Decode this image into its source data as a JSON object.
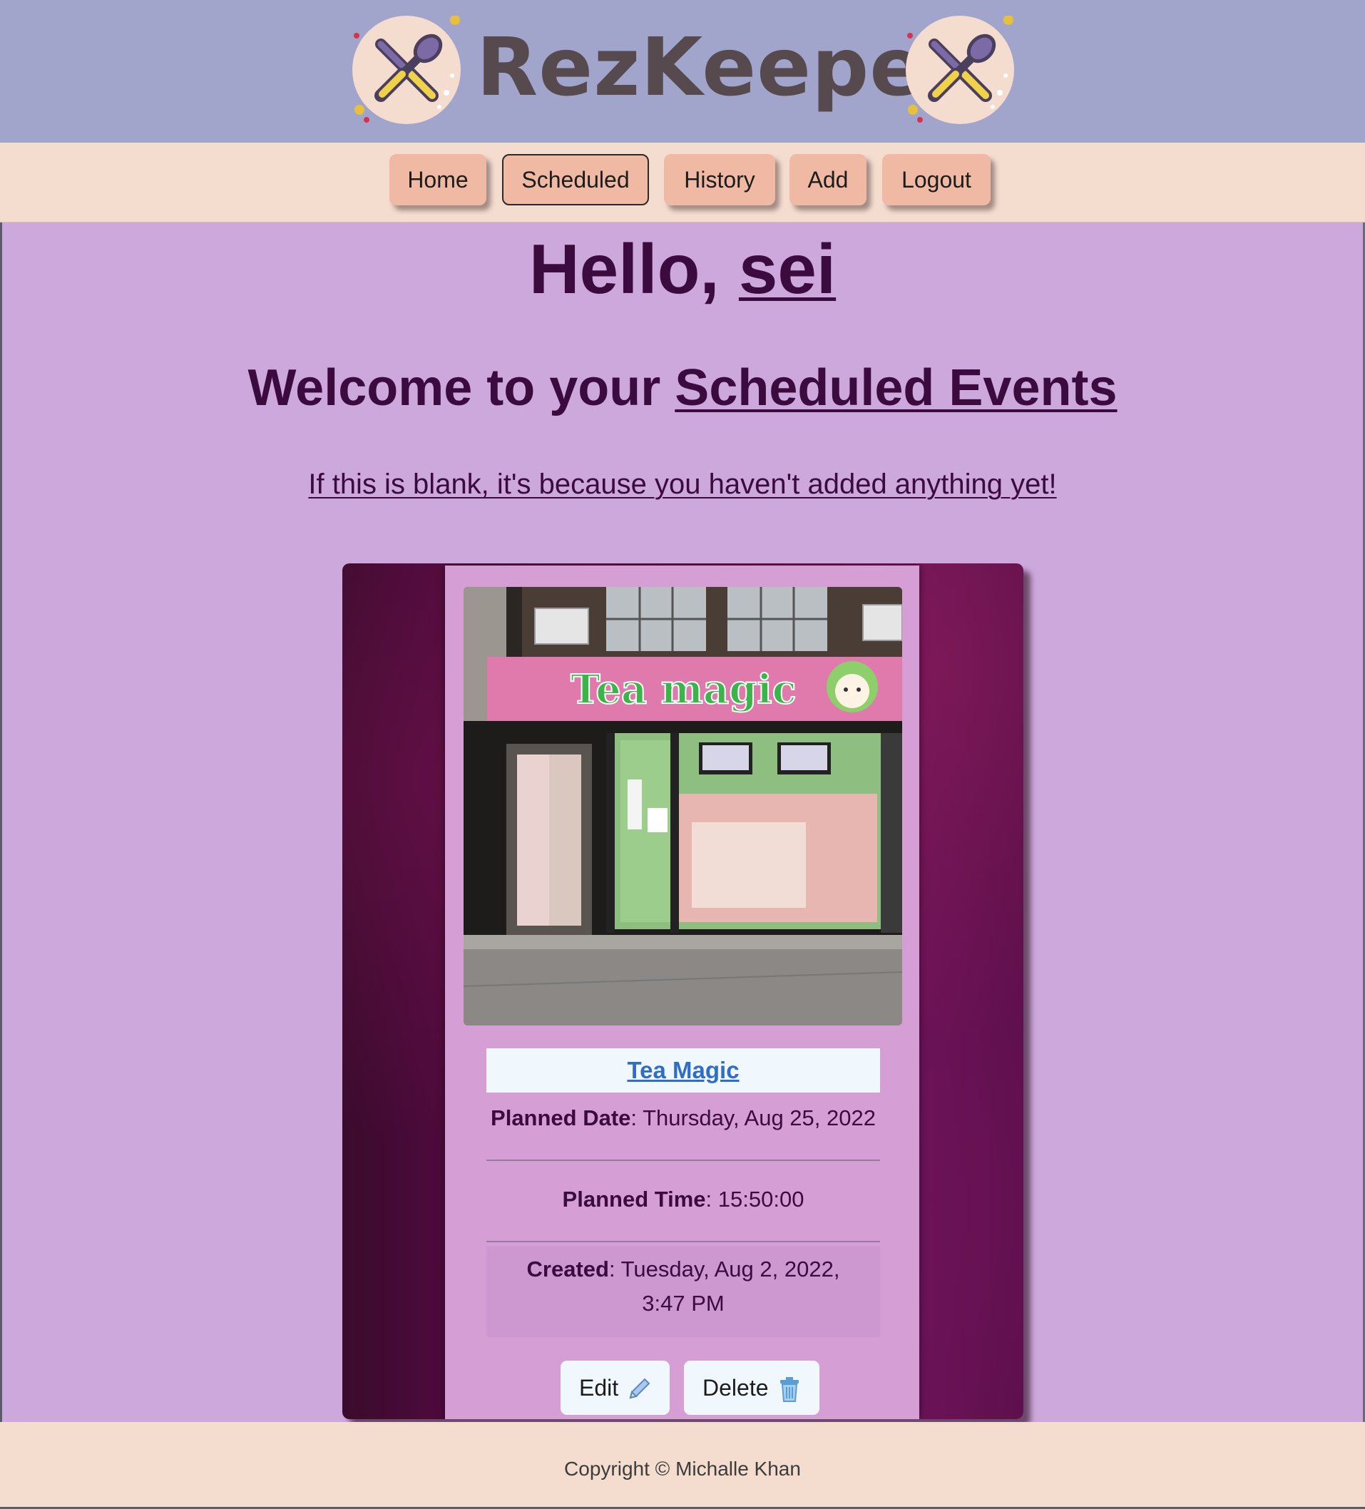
{
  "brand": {
    "name": "RezKeeper"
  },
  "nav": {
    "items": [
      {
        "label": "Home"
      },
      {
        "label": "Scheduled"
      },
      {
        "label": "History"
      },
      {
        "label": "Add"
      },
      {
        "label": "Logout"
      }
    ],
    "active": "Scheduled"
  },
  "greeting": {
    "prefix": "Hello,",
    "username": "sei"
  },
  "welcome": {
    "prefix": "Welcome to your",
    "section": "Scheduled Events"
  },
  "blank_note": "If this is blank, it's because you haven't added anything yet!",
  "event": {
    "name": "Tea Magic",
    "planned_date_label": "Planned Date",
    "planned_date_value": ": Thursday, Aug 25, 2022",
    "planned_time_label": "Planned Time",
    "planned_time_value": ": 15:50:00",
    "created_label": "Created",
    "created_value_line1": ": Tuesday, Aug 2, 2022,",
    "created_value_line2": "3:47 PM",
    "edit_label": "Edit",
    "delete_label": "Delete",
    "sign_text": "Tea magic"
  },
  "footer": {
    "copyright": "Copyright © Michalle Khan"
  },
  "colors": {
    "header_bg": "#a2a5cb",
    "nav_bg": "#f4dccf",
    "page_bg": "#cda8dc",
    "nav_button": "#efb9a4",
    "heading": "#3b0a3f",
    "card_bg": "#d59fd6",
    "link": "#2f6ec8"
  },
  "icons": [
    "crossed-fork-spoon-icon",
    "pencil-icon",
    "trash-icon"
  ]
}
